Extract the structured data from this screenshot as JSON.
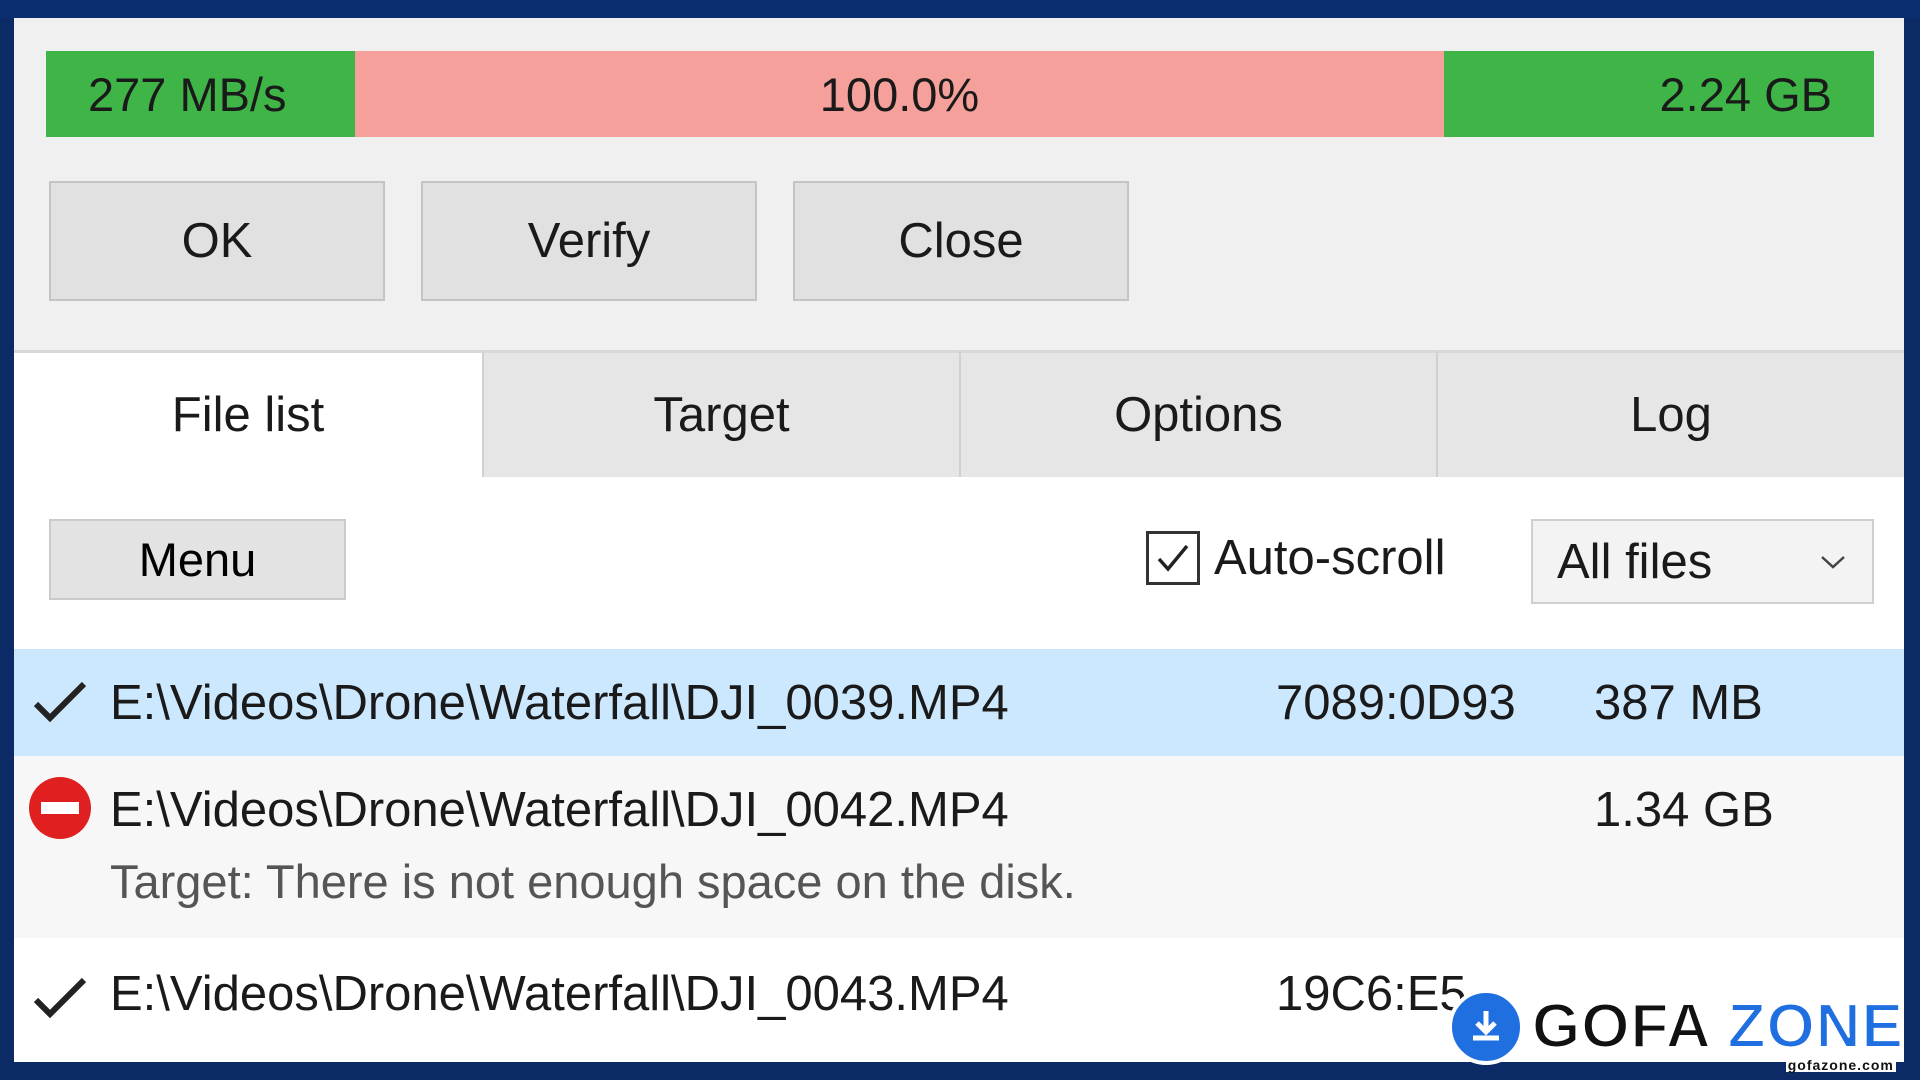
{
  "progress": {
    "speed": "277 MB/s",
    "percent": "100.0%",
    "size": "2.24 GB",
    "colors": {
      "green": "#3fb548",
      "red": "#f5a09a"
    }
  },
  "buttons": {
    "ok": "OK",
    "verify": "Verify",
    "close": "Close"
  },
  "tabs": [
    {
      "label": "File list",
      "active": true
    },
    {
      "label": "Target",
      "active": false
    },
    {
      "label": "Options",
      "active": false
    },
    {
      "label": "Log",
      "active": false
    }
  ],
  "toolbar": {
    "menu_label": "Menu",
    "autoscroll_label": "Auto-scroll",
    "autoscroll_checked": true,
    "filter_value": "All files"
  },
  "files": [
    {
      "status_icon": "checkmark-icon",
      "path": "E:\\Videos\\Drone\\Waterfall\\DJI_0039.MP4",
      "hash": "7089:0D93",
      "size": "387 MB"
    },
    {
      "status_icon": "error-icon",
      "path": "E:\\Videos\\Drone\\Waterfall\\DJI_0042.MP4",
      "hash": "",
      "size": "1.34 GB",
      "message": "Target: There is not enough space on the disk."
    },
    {
      "status_icon": "checkmark-icon",
      "path": "E:\\Videos\\Drone\\Waterfall\\DJI_0043.MP4",
      "hash": "19C6:E5",
      "size": ""
    }
  ],
  "watermark": {
    "brand_a": "GOFA",
    "brand_b": "ZONE",
    "url": "gofazone.com"
  }
}
